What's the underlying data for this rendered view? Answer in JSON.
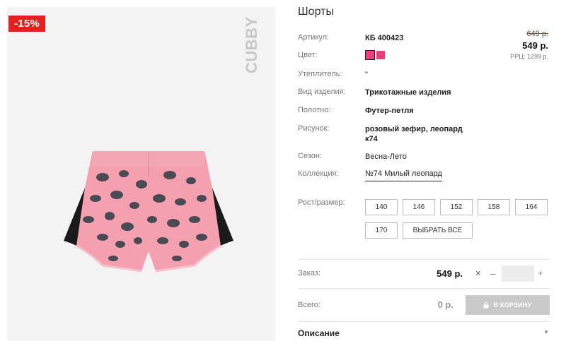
{
  "product": {
    "title": "Шорты",
    "discount": "-15%",
    "brand": "CUBBY"
  },
  "pricing": {
    "old_price": "649 р.",
    "new_price": "549 р.",
    "rrp": "РРЦ: 1299 р."
  },
  "specs": {
    "article_label": "Артикул:",
    "article_value": "КБ 400423",
    "color_label": "Цвет:",
    "color_swatches": [
      "#ee3d7d",
      "#ee3d7d"
    ],
    "insulation_label": "Утеплитель:",
    "insulation_value": "\"",
    "type_label": "Вид изделия:",
    "type_value": "Трикотажные изделия",
    "fabric_label": "Полотно:",
    "fabric_value": "Футер-петля",
    "pattern_label": "Рисунок:",
    "pattern_value_line1": "розовый зефир, леопард",
    "pattern_value_line2": "к74",
    "season_label": "Сезон:",
    "season_value": "Весна-Лето",
    "collection_label": "Коллекция:",
    "collection_value": "№74 Милый леопард"
  },
  "sizes": {
    "label": "Рост/размер:",
    "options": [
      "140",
      "146",
      "152",
      "158",
      "164",
      "170"
    ],
    "select_all": "ВЫБРАТЬ ВСЕ"
  },
  "order": {
    "label": "Заказ:",
    "price": "549 р.",
    "multiply": "×",
    "minus": "–",
    "plus": "+",
    "quantity": ""
  },
  "total": {
    "label": "Всего:",
    "amount": "0 р.",
    "cart_button": "В КОРЗИНУ"
  },
  "description": {
    "label": "Описание"
  },
  "colors": {
    "badge": "#e2201c",
    "swatch": "#ee3d7d",
    "shorts_pink": "#f4a0ae",
    "leopard_dark": "#4a4a55"
  }
}
